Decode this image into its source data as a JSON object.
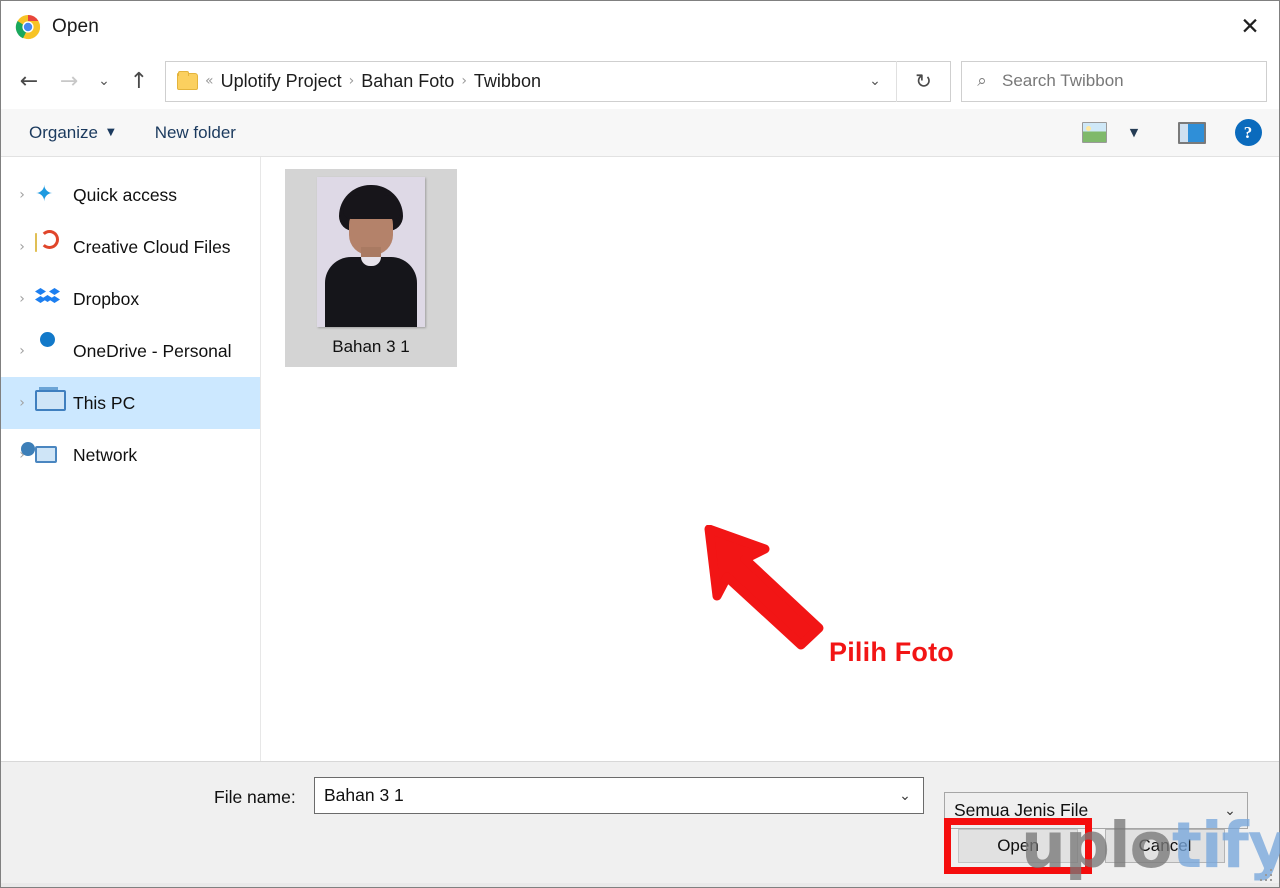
{
  "window": {
    "title": "Open",
    "title_icon": "chrome-logo-icon",
    "close_label": "✕"
  },
  "nav": {
    "back": "←",
    "forward": "→",
    "recent": "⌄",
    "up": "↑",
    "dropdown": "⌄",
    "refresh": "↻"
  },
  "breadcrumb": {
    "folder_icon": "folder-icon",
    "overflow": "«",
    "items": [
      "Uplotify Project",
      "Bahan Foto",
      "Twibbon"
    ],
    "separator": "›"
  },
  "search": {
    "icon": "⌕",
    "placeholder": "Search Twibbon"
  },
  "command_bar": {
    "organize_label": "Organize",
    "organize_caret": "▼",
    "new_folder_label": "New folder",
    "view_caret": "▼",
    "icons": [
      "preview-pane-icon",
      "view-options-caret-icon",
      "layout-pane-icon",
      "help-icon"
    ],
    "help_label": "?"
  },
  "sidebar": {
    "chevron": "›",
    "items": [
      {
        "label": "Quick access",
        "icon": "quick-access-star-icon",
        "selected": false
      },
      {
        "label": "Creative Cloud Files",
        "icon": "creative-cloud-icon",
        "selected": false
      },
      {
        "label": "Dropbox",
        "icon": "dropbox-icon",
        "selected": false
      },
      {
        "label": "OneDrive - Personal",
        "icon": "onedrive-cloud-icon",
        "selected": false
      },
      {
        "label": "This PC",
        "icon": "this-pc-monitor-icon",
        "selected": true
      },
      {
        "label": "Network",
        "icon": "network-icon",
        "selected": false
      }
    ]
  },
  "files": [
    {
      "name": "Bahan 3 1",
      "selected": true,
      "thumbnail": "portrait-photo-thumbnail"
    }
  ],
  "annotation": {
    "arrow": "red-arrow-up-left",
    "text": "Pilih Foto",
    "color": "#f21515"
  },
  "bottom": {
    "filename_label": "File name:",
    "filename_value": "Bahan 3 1",
    "filename_caret": "⌄",
    "filetype_value": "Semua Jenis File",
    "filetype_caret": "⌄",
    "open_label": "Open",
    "cancel_label": "Cancel",
    "open_highlight_color": "#f50d0d"
  },
  "watermark": {
    "part1": "uplo",
    "part2": "tify",
    "part1_color": "#787878",
    "part2_color": "#77a6db"
  }
}
